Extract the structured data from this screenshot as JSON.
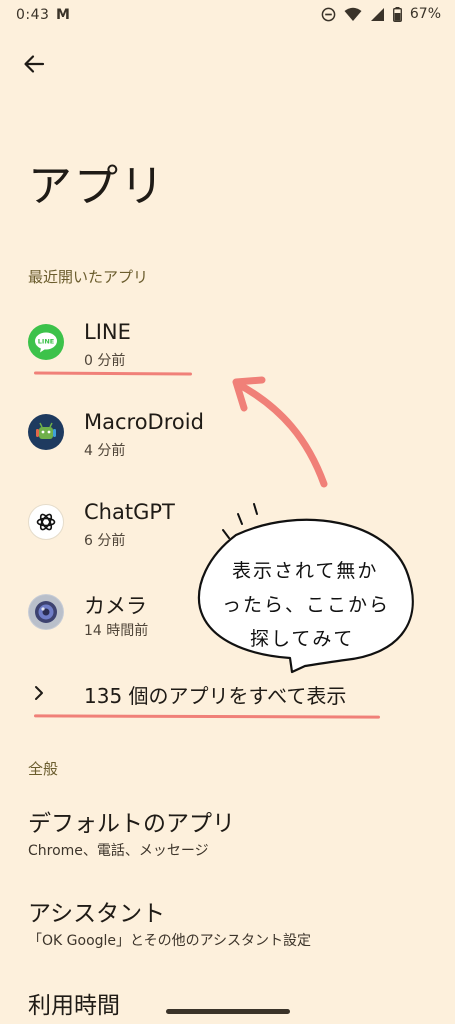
{
  "status_bar": {
    "time": "0:43",
    "app_glyph": "M",
    "battery_percent": "67%"
  },
  "header": {
    "back_icon": "arrow-left-icon",
    "title": "アプリ"
  },
  "recent_section": {
    "title": "最近開いたアプリ",
    "apps": [
      {
        "name": "LINE",
        "time": "0 分前",
        "icon": "line-icon",
        "color": "#3cc24a"
      },
      {
        "name": "MacroDroid",
        "time": "4 分前",
        "icon": "macrodroid-icon",
        "color": "#1e3a5f"
      },
      {
        "name": "ChatGPT",
        "time": "6 分前",
        "icon": "chatgpt-icon",
        "color": "#ffffff"
      },
      {
        "name": "カメラ",
        "time": "14 時間前",
        "icon": "camera-icon",
        "color": "#6f7dc7"
      }
    ],
    "show_all": "135 個のアプリをすべて表示"
  },
  "general_section": {
    "title": "全般",
    "items": [
      {
        "title": "デフォルトのアプリ",
        "subtitle": "Chrome、電話、メッセージ"
      },
      {
        "title": "アシスタント",
        "subtitle": "「OK Google」とその他のアシスタント設定"
      },
      {
        "title": "利用時間",
        "subtitle": ""
      }
    ]
  },
  "annotation": {
    "bubble_lines": [
      "表示されて無か",
      "ったら、ここから",
      "探してみて"
    ],
    "accent_color": "#f08078"
  }
}
